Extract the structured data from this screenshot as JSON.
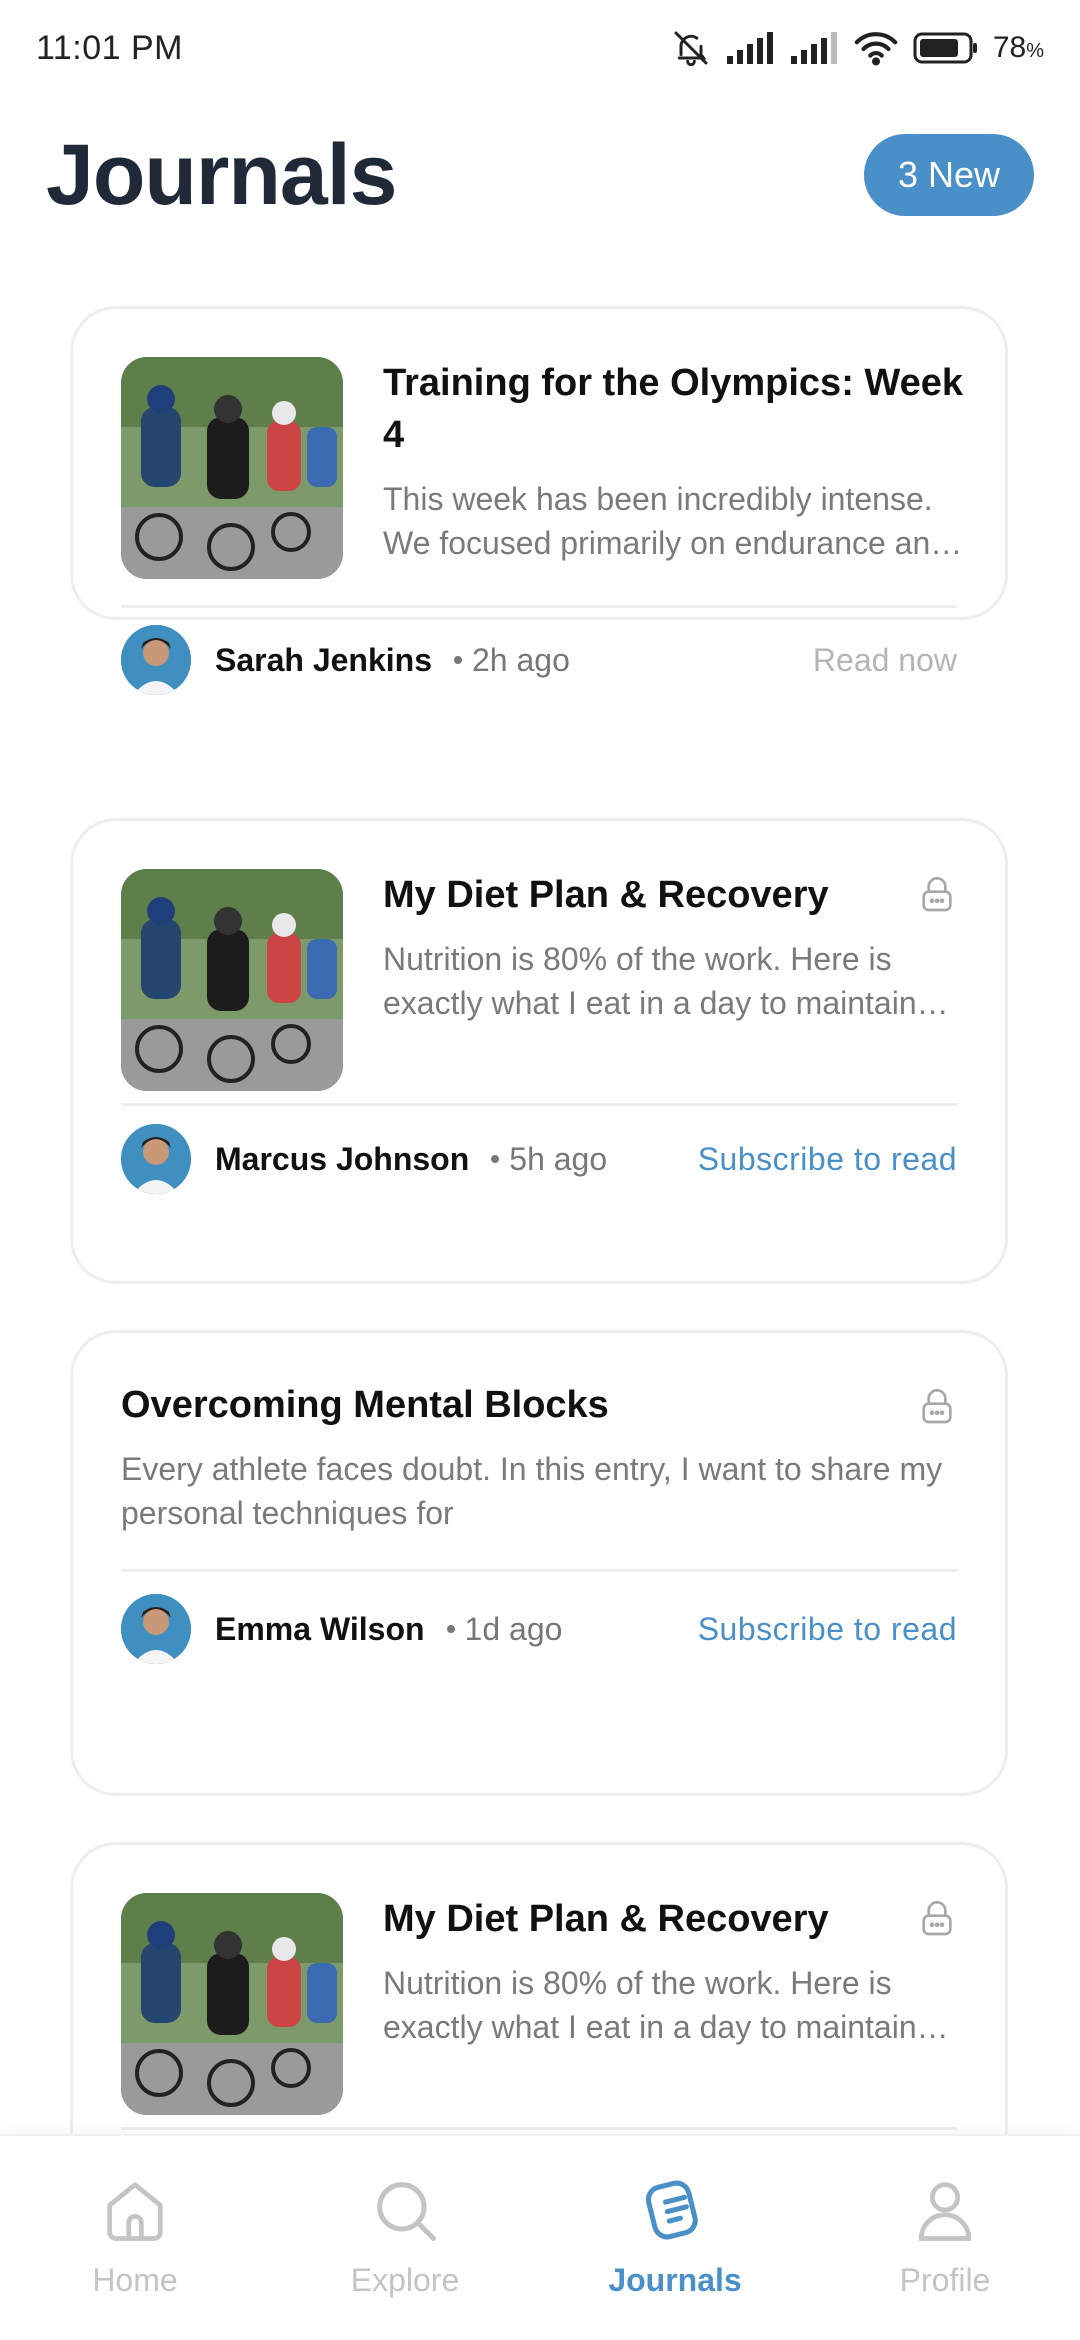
{
  "status_bar": {
    "time": "11:01 PM",
    "battery_percent": "78",
    "battery_unit": "%",
    "icons": [
      "bell-off-icon",
      "signal-icon",
      "signal-icon",
      "wifi-icon",
      "battery-icon"
    ]
  },
  "header": {
    "title": "Journals",
    "new_badge": "3 New"
  },
  "colors": {
    "accent": "#4a90c8",
    "title": "#1f2937",
    "muted": "#7a7a7a",
    "border": "#eeeeee"
  },
  "feed": {
    "cards": [
      {
        "title": "Training for the Olympics: Week 4",
        "excerpt": "This week has been incredibly intense. We focused primarily on endurance and pacing drills.",
        "author": "Sarah Jenkins",
        "time_ago": "2h ago",
        "action": "Read now",
        "locked": false,
        "has_image": true
      },
      {
        "title": "My Diet Plan & Recovery",
        "excerpt": "Nutrition is 80% of the work. Here is exactly what I eat in a day to maintain peak performance.",
        "author": "Marcus Johnson",
        "time_ago": "5h ago",
        "action": "Subscribe to read",
        "locked": true,
        "has_image": true
      },
      {
        "title": "Overcoming Mental Blocks",
        "excerpt": "Every athlete faces doubt. In this entry, I want to share my personal techniques for",
        "author": "Emma Wilson",
        "time_ago": "1d ago",
        "action": "Subscribe to read",
        "locked": true,
        "has_image": false
      },
      {
        "title": "My Diet Plan & Recovery",
        "excerpt": "Nutrition is 80% of the work. Here is exactly what I eat in a day to maintain peak performance.",
        "locked": true,
        "has_image": true
      }
    ]
  },
  "bottom_nav": {
    "items": [
      {
        "label": "Home",
        "icon": "home-icon",
        "active": false
      },
      {
        "label": "Explore",
        "icon": "search-icon",
        "active": false
      },
      {
        "label": "Journals",
        "icon": "journal-icon",
        "active": true
      },
      {
        "label": "Profile",
        "icon": "profile-icon",
        "active": false
      }
    ]
  }
}
